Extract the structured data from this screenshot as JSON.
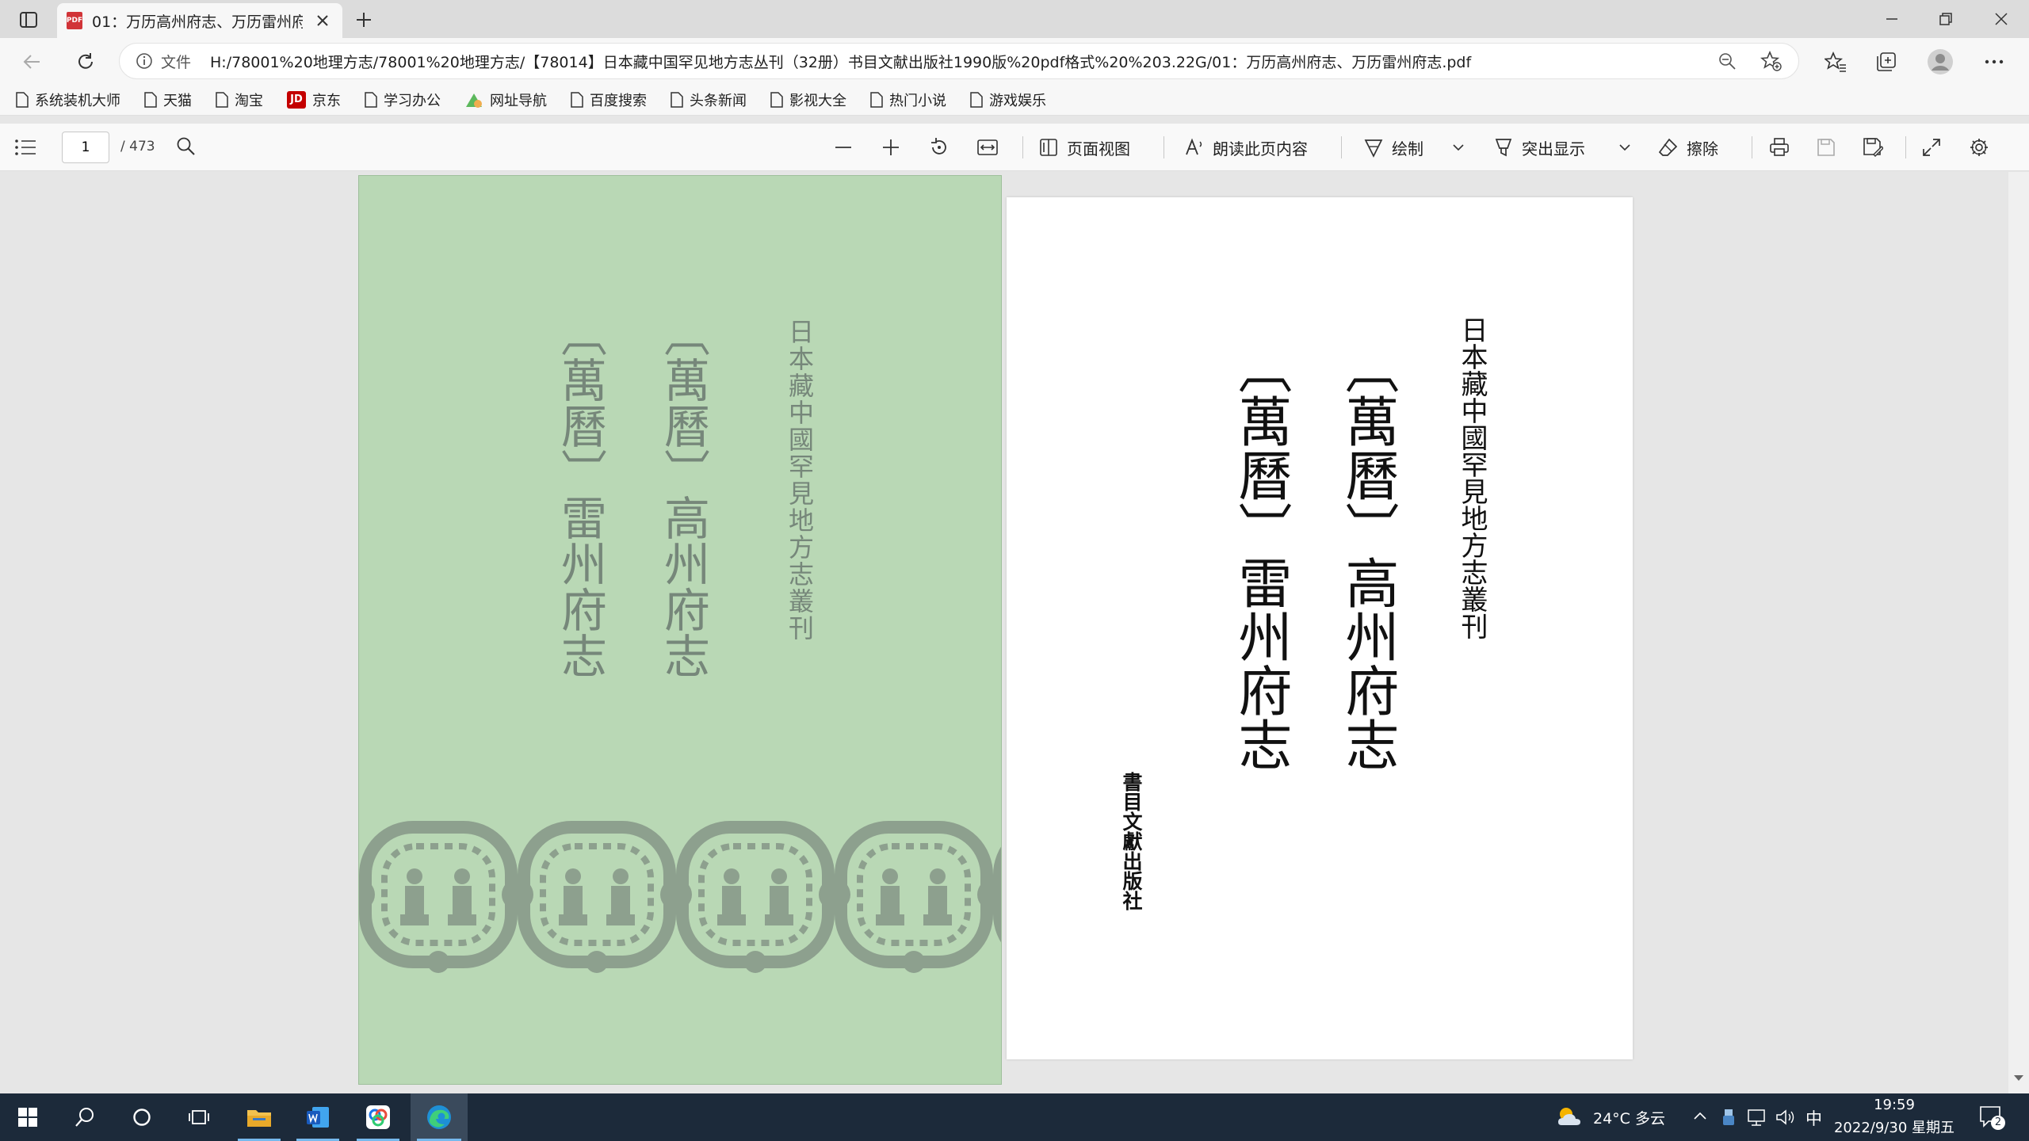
{
  "browser": {
    "tab_title": "01：万历高州府志、万历雷州府志.pdf",
    "address_prefix": "文件",
    "url": "H:/78001%20地理方志/78001%20地理方志/【78014】日本藏中国罕见地方志丛刊（32册）书目文献出版社1990版%20pdf格式%20%203.22G/01：万历高州府志、万历雷州府志.pdf"
  },
  "bookmarks": [
    {
      "label": "系统装机大师",
      "icon": "page-icon"
    },
    {
      "label": "天猫",
      "icon": "page-icon"
    },
    {
      "label": "淘宝",
      "icon": "page-icon"
    },
    {
      "label": "京东",
      "icon": "jd-icon",
      "badge": "JD"
    },
    {
      "label": "学习办公",
      "icon": "page-icon"
    },
    {
      "label": "网址导航",
      "icon": "nav-icon"
    },
    {
      "label": "百度搜索",
      "icon": "page-icon"
    },
    {
      "label": "头条新闻",
      "icon": "page-icon"
    },
    {
      "label": "影视大全",
      "icon": "page-icon"
    },
    {
      "label": "热门小说",
      "icon": "page-icon"
    },
    {
      "label": "游戏娱乐",
      "icon": "page-icon"
    }
  ],
  "pdf_toolbar": {
    "page_current": "1",
    "page_total": "/ 473",
    "page_view": "页面视图",
    "read_aloud": "朗读此页内容",
    "draw": "绘制",
    "highlight": "突出显示",
    "erase": "擦除"
  },
  "document": {
    "series": "日本藏中國罕見地方志叢刊",
    "era": "〔萬曆〕",
    "title_gaozhou": "高州府志",
    "title_leizhou": "雷州府志",
    "publisher": "書目文獻出版社"
  },
  "taskbar": {
    "weather": "24°C 多云",
    "ime": "中",
    "time": "19:59",
    "date": "2022/9/30 星期五",
    "notifications": "2"
  },
  "colors": {
    "cover_green": "#b9d8b5",
    "cover_ink": "#76877a",
    "taskbar": "#1c2a3a",
    "accent": "#0078d4"
  }
}
